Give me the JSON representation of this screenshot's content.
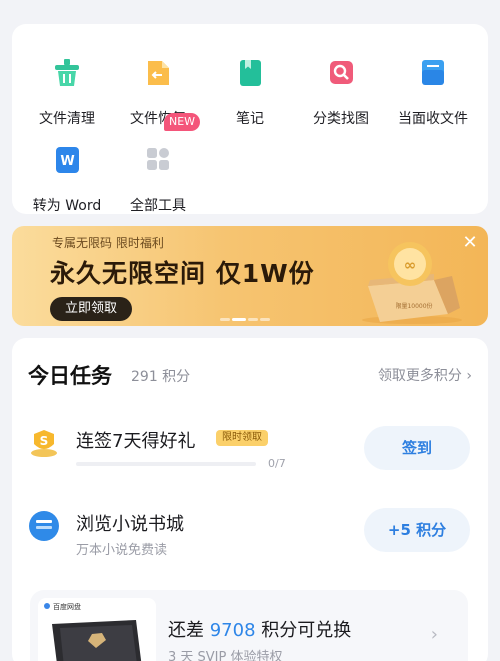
{
  "tools": [
    {
      "label": "文件清理",
      "icon": "file-clean-icon"
    },
    {
      "label": "文件恢复",
      "icon": "file-recover-icon"
    },
    {
      "label": "笔记",
      "icon": "note-icon"
    },
    {
      "label": "分类找图",
      "icon": "image-search-icon"
    },
    {
      "label": "当面收文件",
      "icon": "receive-files-icon"
    },
    {
      "label": "转为 Word",
      "icon": "word-icon"
    },
    {
      "label": "全部工具",
      "icon": "all-tools-icon",
      "badge": "NEW"
    }
  ],
  "banner": {
    "subtitle": "专属无限码 限时福利",
    "title": "永久无限空间  仅1W份",
    "button": "立即领取",
    "close": "✕",
    "box_text": "限量10000份"
  },
  "tasks": {
    "title": "今日任务",
    "points": "291 积分",
    "more": "领取更多积分",
    "items": [
      {
        "title": "连签7天得好礼",
        "tag": "限时领取",
        "progress_text": "0/7",
        "progress": 0,
        "button": "签到"
      },
      {
        "title": "浏览小说书城",
        "subtitle": "万本小说免费读",
        "button": "+5 积分"
      }
    ],
    "redeem": {
      "prefix": "还差 ",
      "number": "9708",
      "suffix": " 积分可兑换",
      "subtitle": "3 天 SVIP 体验特权",
      "brand": "百度网盘"
    }
  },
  "colors": {
    "accent_blue": "#2e86e8",
    "gold": "#f3b657",
    "new_badge": "#f4557a"
  }
}
